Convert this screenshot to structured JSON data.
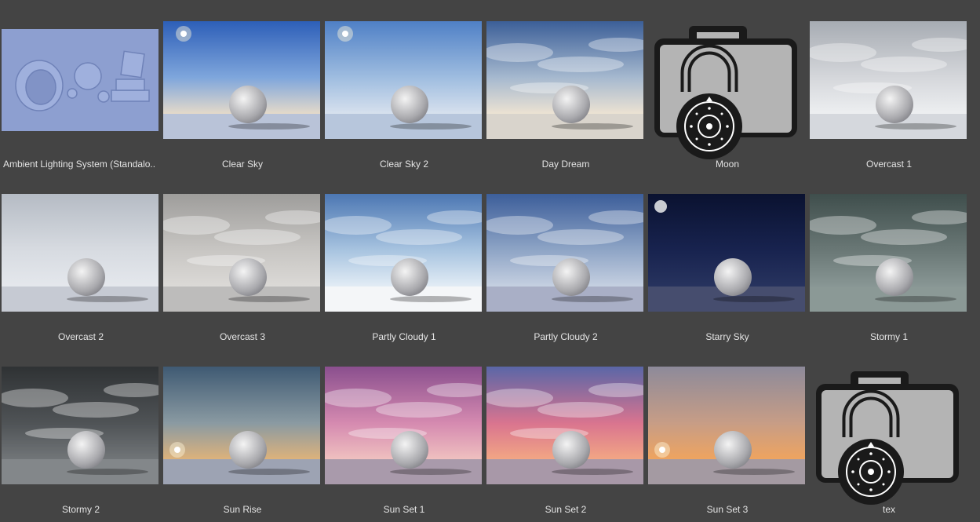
{
  "presets": [
    {
      "label": "Ambient Lighting System (Standalo..",
      "kind": "ambient"
    },
    {
      "label": "Clear Sky",
      "kind": "sky",
      "sky": [
        "#2d5fb8",
        "#7fa6dc",
        "#e9dcc9"
      ],
      "ground": "#b9c3d8",
      "sun": true
    },
    {
      "label": "Clear Sky 2",
      "kind": "sky",
      "sky": [
        "#4f80c6",
        "#9fbde0",
        "#d9e2ee"
      ],
      "ground": "#b7c6dc",
      "sun": true
    },
    {
      "label": "Day Dream",
      "kind": "sky",
      "sky": [
        "#3c5f98",
        "#a6b9cf",
        "#efe4d3"
      ],
      "ground": "#d9d4cc",
      "clouds": true
    },
    {
      "label": "Moon",
      "kind": "locked"
    },
    {
      "label": "Overcast 1",
      "kind": "sky",
      "sky": [
        "#a7acb3",
        "#d5d7db",
        "#eef0f2"
      ],
      "ground": "#d5d8dd",
      "clouds": true
    },
    {
      "label": "Overcast 2",
      "kind": "sky",
      "sky": [
        "#b5bbc4",
        "#d7dbe1",
        "#e5e8ed"
      ],
      "ground": "#c6cad3"
    },
    {
      "label": "Overcast 3",
      "kind": "sky",
      "sky": [
        "#9e9d9b",
        "#c8c6c3",
        "#dcdad7"
      ],
      "ground": "#bdbcbb",
      "clouds": true
    },
    {
      "label": "Partly Cloudy 1",
      "kind": "sky",
      "sky": [
        "#4c77b3",
        "#a8c4e0",
        "#e5eef6"
      ],
      "ground": "#f4f6f8",
      "clouds": true
    },
    {
      "label": "Partly Cloudy 2",
      "kind": "sky",
      "sky": [
        "#3c5e9a",
        "#8fa5c6",
        "#c8d2e2"
      ],
      "ground": "#a9afc6",
      "clouds": true
    },
    {
      "label": "Starry Sky",
      "kind": "sky",
      "sky": [
        "#0a1230",
        "#18234f",
        "#28345f"
      ],
      "ground": "#464d6e",
      "moon": true
    },
    {
      "label": "Stormy 1",
      "kind": "sky",
      "sky": [
        "#3f4e4c",
        "#6a7876",
        "#8a9896"
      ],
      "ground": "#8b9996",
      "clouds": true
    },
    {
      "label": "Stormy 2",
      "kind": "sky",
      "sky": [
        "#2f3234",
        "#4f5356",
        "#73777a"
      ],
      "ground": "#83878a",
      "clouds": true
    },
    {
      "label": "Sun Rise",
      "kind": "sky",
      "sky": [
        "#3f5a73",
        "#8a9aa2",
        "#e0b37a"
      ],
      "ground": "#9da3b3",
      "sun": true,
      "sunLow": true
    },
    {
      "label": "Sun Set 1",
      "kind": "sky",
      "sky": [
        "#8a4f8e",
        "#d58ab0",
        "#f0c2c0"
      ],
      "ground": "#a99aab",
      "clouds": true
    },
    {
      "label": "Sun Set 2",
      "kind": "sky",
      "sky": [
        "#5a66a7",
        "#d9748f",
        "#f3a884"
      ],
      "ground": "#a898a8",
      "clouds": true
    },
    {
      "label": "Sun Set 3",
      "kind": "sky",
      "sky": [
        "#8d8a9a",
        "#c79d86",
        "#f0a45e"
      ],
      "ground": "#a49aa2",
      "sun": true,
      "sunLow": true
    },
    {
      "label": "tex",
      "kind": "locked"
    }
  ]
}
